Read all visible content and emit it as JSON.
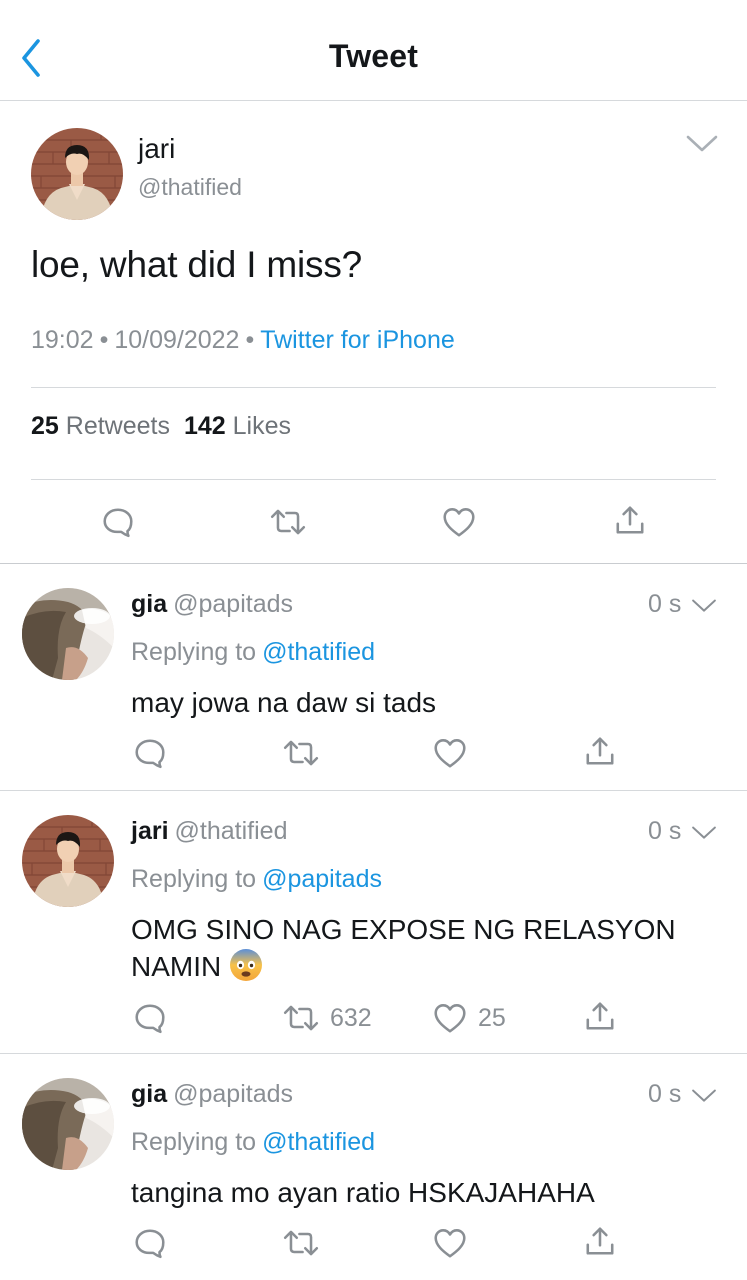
{
  "header": {
    "title": "Tweet",
    "back_icon": "chevron-left-icon"
  },
  "colors": {
    "accent": "#1b95e0",
    "muted": "#8a8f94",
    "text": "#14171a",
    "divider": "#d6d9dc"
  },
  "main_tweet": {
    "author_name": "jari",
    "handle": "@thatified",
    "text": "loe, what did I miss?",
    "time": "19:02",
    "date": "10/09/2022",
    "separator": "•",
    "client": "Twitter for iPhone",
    "retweets_count": "25",
    "retweets_label": "Retweets",
    "likes_count": "142",
    "likes_label": "Likes",
    "actions": [
      "reply-icon",
      "retweet-icon",
      "like-icon",
      "share-icon"
    ]
  },
  "replies": [
    {
      "name": "gia",
      "handle": "@papitads",
      "time": "0 s",
      "replying_label": "Replying to",
      "replying_to": "@thatified",
      "text": "may jowa na daw si tads",
      "retweets": "",
      "likes": ""
    },
    {
      "name": "jari",
      "handle": "@thatified",
      "time": "0 s",
      "replying_label": "Replying to",
      "replying_to": "@papitads",
      "text": "OMG SINO NAG EXPOSE NG RELASYON NAMIN",
      "emoji": "fearful-face-emoji",
      "retweets": "632",
      "likes": "25"
    },
    {
      "name": "gia",
      "handle": "@papitads",
      "time": "0 s",
      "replying_label": "Replying to",
      "replying_to": "@thatified",
      "text": "tangina mo ayan ratio HSKAJAHAHA",
      "retweets": "",
      "likes": ""
    }
  ]
}
